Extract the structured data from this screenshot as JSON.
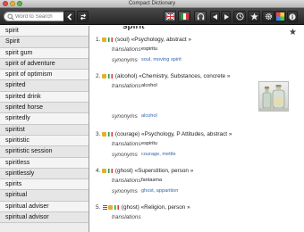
{
  "window": {
    "title": "Compact Dictionary"
  },
  "search": {
    "placeholder": "Word to Search"
  },
  "toolbar": {
    "icons": [
      "back-icon",
      "forward-icon",
      "flag-en-it-icon",
      "flag-it-en-icon",
      "headphones-icon",
      "history-back-icon",
      "history-forward-icon",
      "clock-icon",
      "star-icon",
      "gear-icon",
      "color-icon",
      "info-icon",
      "help-icon"
    ]
  },
  "word_list": [
    "spirit",
    "Spirit",
    "spirit gum",
    "spirit of adventure",
    "spirit of optimism",
    "spirited",
    "spirited drink",
    "spirited horse",
    "spiritedly",
    "spiritist",
    "spiritistic",
    "spiritistic session",
    "spiritless",
    "spiritlessly",
    "spirits",
    "spiritual",
    "spiritual adviser",
    "spiritual advisor"
  ],
  "content": {
    "headword": "spirit",
    "entries": [
      {
        "num": "1.",
        "head": "(soul) «Psychology, abstract »",
        "translations_label": "translations",
        "translations": "espiritu",
        "synonyms_label": "synonyms",
        "synonyms": "soul, moving spirit"
      },
      {
        "num": "2.",
        "head": "(alcohol) «Chemistry, Substances, concrete »",
        "translations_label": "translations",
        "translations": "alcohol",
        "synonyms_label": "synonyms",
        "synonyms": "alcohol"
      },
      {
        "num": "3.",
        "head": "(courage) «Psychology, P Attitudes, abstract »",
        "translations_label": "translations",
        "translations": "espiritu",
        "synonyms_label": "synonyms",
        "synonyms": "courage, mettle"
      },
      {
        "num": "4.",
        "head": "(ghost) «Superstition, person »",
        "translations_label": "translations",
        "translations": "fantasma",
        "synonyms_label": "synonyms",
        "synonyms": "ghost, apparition"
      },
      {
        "num": "5.",
        "head": "(ghost) «Religion, person »",
        "translations_label": "translations",
        "translations": ""
      }
    ]
  }
}
